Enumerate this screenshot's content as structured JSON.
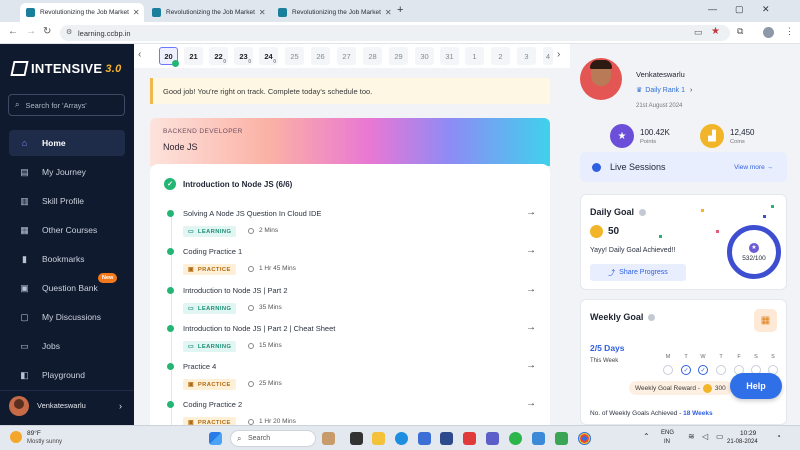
{
  "browser": {
    "tabs": [
      {
        "title": "Revolutionizing the Job Market",
        "active": true
      },
      {
        "title": "Revolutionizing the Job Market",
        "active": false
      },
      {
        "title": "Revolutionizing the Job Market",
        "active": false
      }
    ],
    "url": "learning.ccbp.in"
  },
  "sidebar": {
    "logo_text": "INTENSIVE",
    "logo_version": "3.0",
    "search_placeholder": "Search for 'Arrays'",
    "items": [
      {
        "label": "Home",
        "active": true,
        "icon": "home-icon"
      },
      {
        "label": "My Journey",
        "icon": "map-icon"
      },
      {
        "label": "Skill Profile",
        "icon": "chart-icon"
      },
      {
        "label": "Other Courses",
        "icon": "courses-icon"
      },
      {
        "label": "Bookmarks",
        "icon": "bookmark-icon"
      },
      {
        "label": "Question Bank",
        "icon": "question-bank-icon",
        "badge": "New"
      },
      {
        "label": "My Discussions",
        "icon": "chat-icon"
      },
      {
        "label": "Jobs",
        "icon": "briefcase-icon"
      },
      {
        "label": "Playground",
        "icon": "playground-icon"
      }
    ],
    "user_name": "Venkateswarlu"
  },
  "dates": {
    "days": [
      "20",
      "21",
      "22",
      "23",
      "24",
      "25",
      "26",
      "27",
      "28",
      "29",
      "30",
      "31",
      "1",
      "2",
      "3",
      "4"
    ],
    "selected": "20",
    "zero_marks": [
      "0",
      "0",
      "0"
    ]
  },
  "notice": "Good job! You're right on track. Complete today's schedule too.",
  "course": {
    "track": "BACKEND DEVELOPER",
    "title": "Node JS",
    "module": "Introduction to Node JS (6/6)",
    "lessons": [
      {
        "title": "Solving A Node JS Question In Cloud IDE",
        "tag": "LEARNING",
        "duration": "2 Mins"
      },
      {
        "title": "Coding Practice 1",
        "tag": "PRACTICE",
        "duration": "1 Hr 45 Mins"
      },
      {
        "title": "Introduction to Node JS | Part 2",
        "tag": "LEARNING",
        "duration": "35 Mins"
      },
      {
        "title": "Introduction to Node JS | Part 2 | Cheat Sheet",
        "tag": "LEARNING",
        "duration": "15 Mins"
      },
      {
        "title": "Practice 4",
        "tag": "PRACTICE",
        "duration": "25 Mins"
      },
      {
        "title": "Coding Practice 2",
        "tag": "PRACTICE",
        "duration": "1 Hr 20 Mins"
      }
    ]
  },
  "profile": {
    "name": "Venkateswarlu",
    "rank": "Daily Rank 1",
    "date": "21st August 2024",
    "points_value": "100.42K",
    "points_label": "Points",
    "coins_value": "12,450",
    "coins_label": "Coins"
  },
  "live": {
    "title": "Live Sessions",
    "view_more": "View more"
  },
  "daily_goal": {
    "title": "Daily Goal",
    "coins": "50",
    "message": "Yayy! Daily Goal Achieved!!",
    "share_label": "Share Progress",
    "progress_text": "532/100"
  },
  "weekly_goal": {
    "title": "Weekly Goal",
    "days_done": "2/5 Days",
    "this_week": "This Week",
    "weekdays": [
      "M",
      "T",
      "W",
      "T",
      "F",
      "S",
      "S"
    ],
    "reward_label": "Weekly Goal Reward -",
    "reward_value": "300",
    "achieved_label": "No. of Weekly Goals Achieved -",
    "achieved_value": "18 Weeks"
  },
  "help_label": "Help",
  "taskbar": {
    "weather_temp": "89°F",
    "weather_desc": "Mostly sunny",
    "search_label": "Search",
    "lang": "ENG",
    "region": "IN",
    "time": "10:29",
    "date": "21-08-2024"
  },
  "colors": {
    "accent": "#2f5fe0",
    "sidebar_bg": "#101a2e",
    "success": "#22b573"
  }
}
